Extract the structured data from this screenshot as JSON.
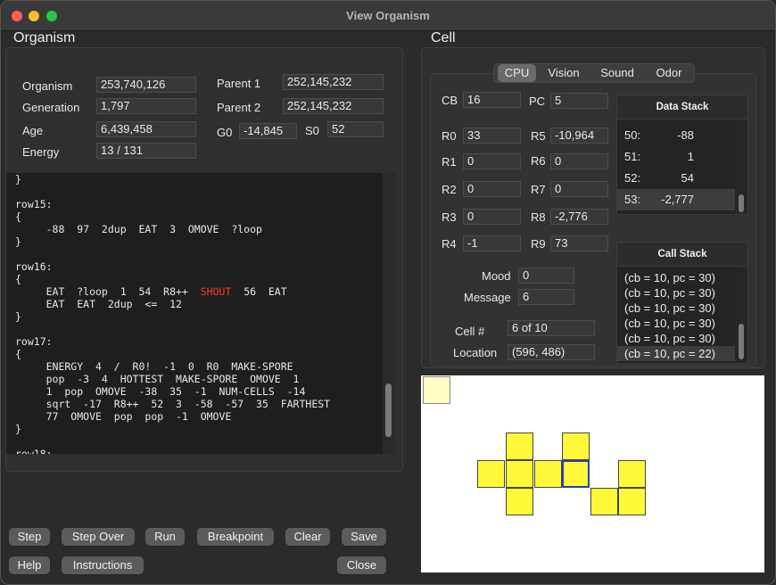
{
  "window": {
    "title": "View Organism"
  },
  "organism": {
    "section_title": "Organism",
    "organism_label": "Organism",
    "organism_value": "253,740,126",
    "generation_label": "Generation",
    "generation_value": "1,797",
    "age_label": "Age",
    "age_value": "6,439,458",
    "energy_label": "Energy",
    "energy_value": "13 / 131",
    "parent1_label": "Parent 1",
    "parent1_value": "252,145,232",
    "parent2_label": "Parent 2",
    "parent2_value": "252,145,232",
    "g0_label": "G0",
    "g0_value": "-14,845",
    "s0_label": "S0",
    "s0_value": "52"
  },
  "code": {
    "lines": [
      "}",
      "",
      "row15:",
      "{",
      "     -88  97  2dup  EAT  3  OMOVE  ?loop",
      "}",
      "",
      "row16:",
      "{",
      "     EAT  ?loop  1  54  R8++  ",
      "     EAT  EAT  2dup  <=  12",
      "}",
      "",
      "row17:",
      "{",
      "     ENERGY  4  /  R0!  -1  0  R0  MAKE-SPORE",
      "     pop  -3  4  HOTTEST  MAKE-SPORE  OMOVE  1",
      "     1  pop  OMOVE  -38  35  -1  NUM-CELLS  -14",
      "     sqrt  -17  R8++  52  3  -58  -57  35  FARTHEST",
      "     77  OMOVE  pop  pop  -1  OMOVE",
      "}",
      "",
      "row18:"
    ],
    "shout_word": "SHOUT",
    "shout_tail": "  56  EAT"
  },
  "buttons": {
    "step": "Step",
    "step_over": "Step Over",
    "run": "Run",
    "breakpoint": "Breakpoint",
    "clear": "Clear",
    "save": "Save",
    "help": "Help",
    "instructions": "Instructions",
    "close": "Close"
  },
  "cell": {
    "section_title": "Cell",
    "tabs": [
      "CPU",
      "Vision",
      "Sound",
      "Odor"
    ],
    "active_tab": "CPU",
    "registers": {
      "cb_label": "CB",
      "cb": "16",
      "pc_label": "PC",
      "pc": "5",
      "r0_label": "R0",
      "r0": "33",
      "r5_label": "R5",
      "r5": "-10,964",
      "r1_label": "R1",
      "r1": "0",
      "r6_label": "R6",
      "r6": "0",
      "r2_label": "R2",
      "r2": "0",
      "r7_label": "R7",
      "r7": "0",
      "r3_label": "R3",
      "r3": "0",
      "r8_label": "R8",
      "r8": "-2,776",
      "r4_label": "R4",
      "r4": "-1",
      "r9_label": "R9",
      "r9": "73"
    },
    "mood_label": "Mood",
    "mood": "0",
    "message_label": "Message",
    "message": "6",
    "cellnum_label": "Cell #",
    "cellnum": "6 of 10",
    "location_label": "Location",
    "location": "(596, 486)",
    "data_stack": {
      "title": "Data Stack",
      "rows": [
        {
          "idx": "50:",
          "val": "-88"
        },
        {
          "idx": "51:",
          "val": "1"
        },
        {
          "idx": "52:",
          "val": "54"
        },
        {
          "idx": "53:",
          "val": "-2,777"
        }
      ],
      "selected_index": 3
    },
    "call_stack": {
      "title": "Call Stack",
      "rows": [
        "(cb = 10, pc = 30)",
        "(cb = 10, pc = 30)",
        "(cb = 10, pc = 30)",
        "(cb = 10, pc = 30)",
        "(cb = 10, pc = 30)",
        "(cb = 10, pc = 22)"
      ],
      "selected_index": 5
    }
  },
  "colors": {
    "cell_fill": "#fff83a",
    "selected_cell_border": "#1e44b8",
    "shout": "#ff3b30"
  }
}
